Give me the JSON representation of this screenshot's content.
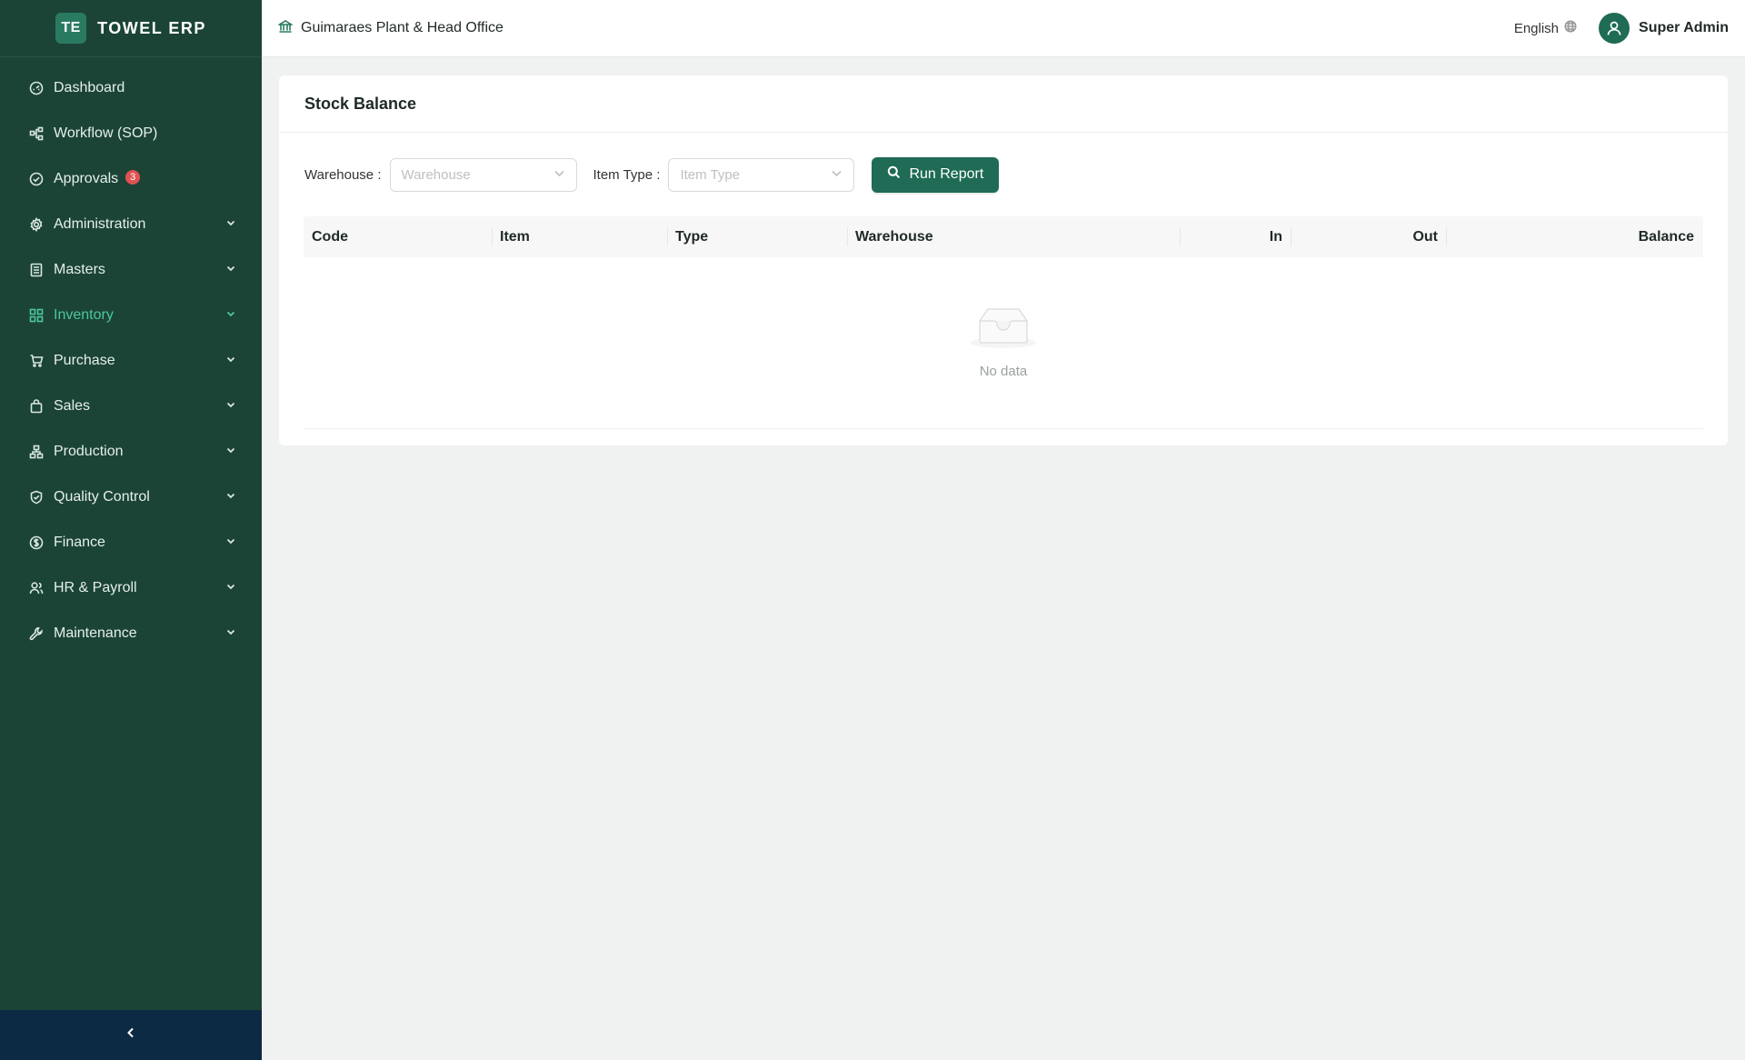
{
  "brand": {
    "logo": "TE",
    "name": "TOWEL ERP"
  },
  "sidebar": {
    "items": [
      {
        "label": "Dashboard",
        "icon": "dashboard-icon",
        "has_chevron": false
      },
      {
        "label": "Workflow (SOP)",
        "icon": "workflow-icon",
        "has_chevron": false
      },
      {
        "label": "Approvals",
        "icon": "check-circle-icon",
        "has_chevron": false,
        "badge": "3"
      },
      {
        "label": "Administration",
        "icon": "gear-icon",
        "has_chevron": true
      },
      {
        "label": "Masters",
        "icon": "book-icon",
        "has_chevron": true
      },
      {
        "label": "Inventory",
        "icon": "grid-icon",
        "has_chevron": true,
        "active": true
      },
      {
        "label": "Purchase",
        "icon": "cart-icon",
        "has_chevron": true
      },
      {
        "label": "Sales",
        "icon": "bag-icon",
        "has_chevron": true
      },
      {
        "label": "Production",
        "icon": "hierarchy-icon",
        "has_chevron": true
      },
      {
        "label": "Quality Control",
        "icon": "shield-check-icon",
        "has_chevron": true
      },
      {
        "label": "Finance",
        "icon": "dollar-icon",
        "has_chevron": true
      },
      {
        "label": "HR & Payroll",
        "icon": "users-icon",
        "has_chevron": true
      },
      {
        "label": "Maintenance",
        "icon": "wrench-icon",
        "has_chevron": true
      }
    ]
  },
  "header": {
    "org_name": "Guimaraes Plant & Head Office",
    "language": "English",
    "user_name": "Super Admin"
  },
  "page": {
    "title": "Stock Balance",
    "filters": {
      "warehouse_label": "Warehouse",
      "warehouse_placeholder": "Warehouse",
      "item_type_label": "Item Type",
      "item_type_placeholder": "Item Type",
      "run_label": "Run Report"
    },
    "table": {
      "columns": [
        "Code",
        "Item",
        "Type",
        "Warehouse",
        "In",
        "Out",
        "Balance"
      ],
      "rows": [],
      "empty_text": "No data"
    }
  },
  "colors": {
    "sidebar_bg": "#1b4437",
    "accent": "#1f6b55",
    "active_text": "#4cc79c",
    "badge": "#e05252",
    "collapse_bar": "#0d2a44"
  }
}
